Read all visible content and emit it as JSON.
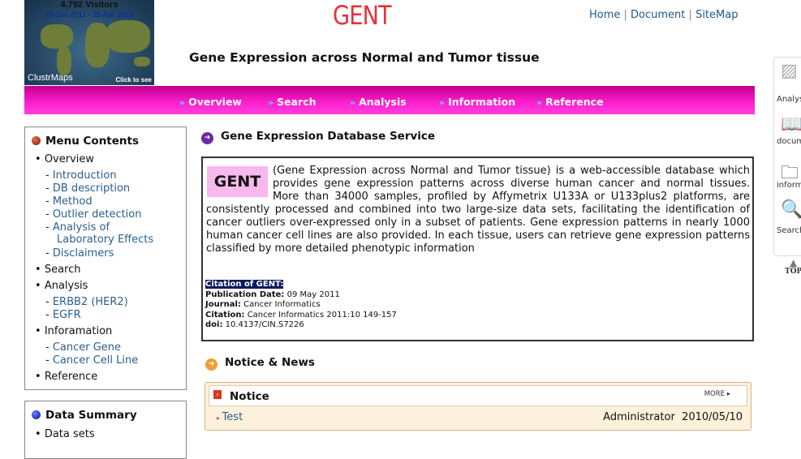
{
  "clustrmap": {
    "visitors": "4,792 Visitors",
    "range": "28 Jun 2011 - 25 Apr 2013",
    "brand": "ClustrMaps",
    "click": "Click to see"
  },
  "logo": "GENT",
  "top_links": [
    "Home",
    "Document",
    "SiteMap"
  ],
  "subtitle": "Gene Expression across Normal and Tumor tissue",
  "nav": [
    "Overview",
    "Search",
    "Analysis",
    "Information",
    "Reference"
  ],
  "menu": {
    "title": "Menu Contents",
    "items": [
      {
        "label": "Overview",
        "sub": [
          "Introduction",
          "DB description",
          "Method",
          "Outlier detection",
          "Analysis of",
          "Laboratory Effects",
          "Disclaimers"
        ]
      },
      {
        "label": "Search",
        "sub": []
      },
      {
        "label": "Analysis",
        "sub": [
          "ERBB2 (HER2)",
          "EGFR"
        ]
      },
      {
        "label": "Inforamation",
        "sub": [
          "Cancer Gene",
          "Cancer Cell Line"
        ]
      },
      {
        "label": "Reference",
        "sub": []
      }
    ]
  },
  "data_summary": {
    "title": "Data Summary",
    "items": [
      "Data sets"
    ]
  },
  "main": {
    "section_title": "Gene Expression Database Service",
    "badge": "GENT",
    "description": "(Gene Expression across Normal and Tumor tissue) is a web-accessible database which provides gene expression patterns across diverse human cancer and normal tissues. More than 34000 samples, profiled by Affymetrix U133A or U133plus2 platforms, are consistently processed and combined into two large-size data sets, facilitating the identification of cancer outliers over-expressed only in a subset of patients. Gene expression patterns in nearly 1000 human cancer cell lines are also provided. In each tissue, users can retrieve gene expression patterns classified by more detailed phenotypic information",
    "citation": {
      "title": "Citation of GENT:",
      "pub_label": "Publication Date:",
      "pub": "09 May 2011",
      "journal_label": "Journal:",
      "journal": "Cancer Informatics",
      "citation_label": "Citation:",
      "citation": "Cancer Informatics 2011:10 149-157",
      "doi_label": "doi:",
      "doi": "10.4137/CIN.S7226"
    },
    "news_title": "Notice & News",
    "notice": {
      "title": "Notice",
      "more": "MORE",
      "rows": [
        {
          "title": "Test",
          "author": "Administrator",
          "date": "2010/05/10"
        }
      ]
    }
  },
  "right_quick": [
    "Analysis",
    "document",
    "information",
    "Search",
    "TOP"
  ]
}
